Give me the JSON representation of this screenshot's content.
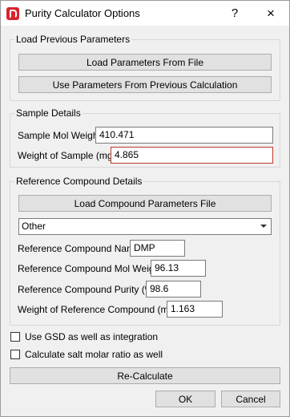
{
  "window": {
    "title": "Purity Calculator Options",
    "help_icon": "?",
    "close_icon": "×"
  },
  "load_previous": {
    "legend": "Load Previous Parameters",
    "load_file_button": "Load Parameters From File",
    "use_previous_button": "Use Parameters From Previous Calculation"
  },
  "sample": {
    "legend": "Sample Details",
    "mol_weight_label": "Sample Mol Weight",
    "mol_weight_value": "410.471",
    "weight_label": "Weight of Sample (mg)",
    "weight_value": "4.865"
  },
  "reference": {
    "legend": "Reference Compound Details",
    "load_button": "Load Compound Parameters File",
    "selected_option": "Other",
    "name_label": "Reference Compound Name",
    "name_value": "DMP",
    "mol_weight_label": "Reference Compound Mol Weight",
    "mol_weight_value": "96.13",
    "purity_label": "Reference Compound Purity (%)",
    "purity_value": "98.6",
    "weight_label": "Weight of Reference Compound (mg)",
    "weight_value": "1.163"
  },
  "options": {
    "gsd_label": "Use GSD as well as integration",
    "salt_label": "Calculate salt molar ratio as well"
  },
  "buttons": {
    "recalculate": "Re-Calculate",
    "ok": "OK",
    "cancel": "Cancel"
  },
  "colors": {
    "error_border": "#c0392b",
    "brand_icon": "#d9232d"
  }
}
